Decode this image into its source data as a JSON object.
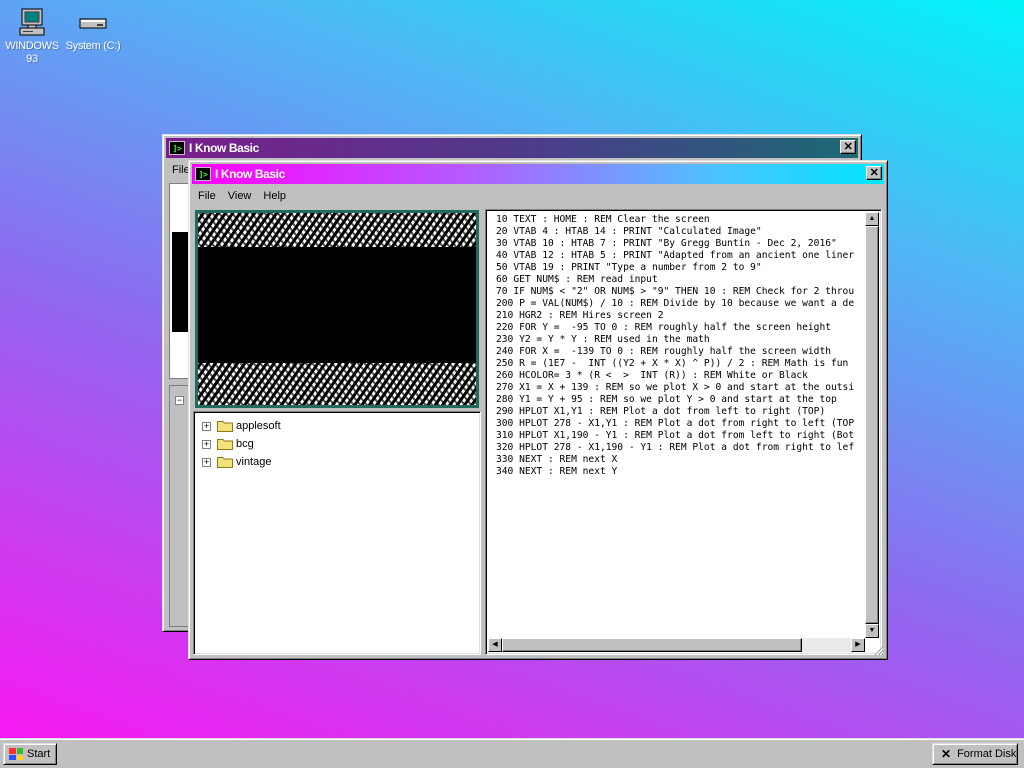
{
  "desktop": {
    "icons": [
      {
        "label": "WINDOWS 93",
        "icon": "computer-icon"
      },
      {
        "label": "System (C:)",
        "icon": "drive-icon"
      }
    ]
  },
  "back_window": {
    "title": "I Know Basic",
    "menu_first": "File"
  },
  "window": {
    "title": "I Know Basic",
    "menu": [
      "File",
      "View",
      "Help"
    ],
    "tree": [
      {
        "label": "applesoft",
        "expander": "+"
      },
      {
        "label": "bcg",
        "expander": "+"
      },
      {
        "label": "vintage",
        "expander": "+"
      }
    ],
    "code_lines": [
      "10 TEXT : HOME : REM Clear the screen",
      "20 VTAB 4 : HTAB 14 : PRINT \"Calculated Image\"",
      "30 VTAB 10 : HTAB 7 : PRINT \"By Gregg Buntin - Dec 2, 2016\"",
      "40 VTAB 12 : HTAB 5 : PRINT \"Adapted from an ancient one liner",
      "50 VTAB 19 : PRINT \"Type a number from 2 to 9\"",
      "60 GET NUM$ : REM read input",
      "70 IF NUM$ < \"2\" OR NUM$ > \"9\" THEN 10 : REM Check for 2 throu",
      "200 P = VAL(NUM$) / 10 : REM Divide by 10 because we want a de",
      "210 HGR2 : REM Hires screen 2",
      "220 FOR Y =  -95 TO 0 : REM roughly half the screen height",
      "230 Y2 = Y * Y : REM used in the math",
      "240 FOR X =  -139 TO 0 : REM roughly half the screen width",
      "250 R = (1E7 -  INT ((Y2 + X * X) ^ P)) / 2 : REM Math is fun",
      "260 HCOLOR= 3 * (R <  >  INT (R)) : REM White or Black",
      "270 X1 = X + 139 : REM so we plot X > 0 and start at the outsi",
      "280 Y1 = Y + 95 : REM so we plot Y > 0 and start at the top",
      "290 HPLOT X1,Y1 : REM Plot a dot from left to right (TOP)",
      "300 HPLOT 278 - X1,Y1 : REM Plot a dot from right to left (TOP",
      "310 HPLOT X1,190 - Y1 : REM Plot a dot from left to right (Bot",
      "320 HPLOT 278 - X1,190 - Y1 : REM Plot a dot from right to lef",
      "330 NEXT : REM next X",
      "340 NEXT : REM next Y"
    ]
  },
  "taskbar": {
    "start_label": "Start",
    "task_label": "Format Disk"
  },
  "colors": {
    "title_active_start": "#ff00ff",
    "title_active_end": "#00e8ff",
    "title_inactive_start": "#7a1d8c",
    "title_inactive_end": "#1c6a74",
    "preview_border": "#1f6b5e"
  }
}
